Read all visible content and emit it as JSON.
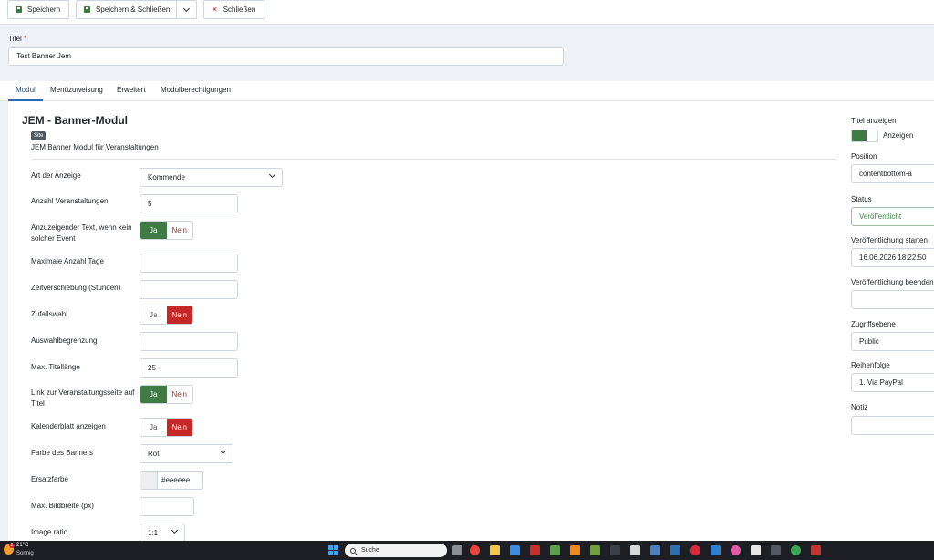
{
  "toolbar": {
    "save": "Speichern",
    "save_close": "Speichern & Schließen",
    "close": "Schließen"
  },
  "title_field": {
    "label": "Titel",
    "required": "*",
    "value": "Test Banner Jem"
  },
  "tabs": [
    "Modul",
    "Menüzuweisung",
    "Erweitert",
    "Modulberechtigungen"
  ],
  "module": {
    "name": "JEM - Banner-Modul",
    "badge": "Site",
    "description": "JEM Banner Modul für Veranstaltungen"
  },
  "fields": {
    "art_label": "Art der Anzeige",
    "art_value": "Kommende",
    "anzahl_label": "Anzahl Veranstaltungen",
    "anzahl_value": "5",
    "text_label": "Anzuzeigender Text, wenn kein solcher Event",
    "max_tage_label": "Maximale Anzahl Tage",
    "zeit_label": "Zeitverschiebung (Stunden)",
    "zufall_label": "Zufallswahl",
    "auswahl_label": "Auswahlbegrenzung",
    "titel_len_label": "Max. Titellänge",
    "titel_len_value": "25",
    "link_label": "Link zur Veranstaltungsseite auf Titel",
    "kalender_label": "Kalenderblatt anzeigen",
    "farbe_label": "Farbe des Banners",
    "farbe_value": "Rot",
    "ersatz_label": "Ersatzfarbe",
    "ersatz_value": "#eeeeee",
    "bildbreite_label": "Max. Bildbreite (px)",
    "ratio_label": "Image ratio",
    "ratio_value": "1:1"
  },
  "switch": {
    "ja": "Ja",
    "nein": "Nein"
  },
  "sidebar": {
    "titel_anzeigen_label": "Titel anzeigen",
    "titel_anzeigen_value": "Anzeigen",
    "position_label": "Position",
    "position_value": "contentbottom-a",
    "status_label": "Status",
    "status_value": "Veröffentlicht",
    "start_label": "Veröffentlichung starten",
    "start_value": "16.06.2026 18:22:50",
    "ende_label": "Veröffentlichung beenden",
    "zugriff_label": "Zugriffsebene",
    "zugriff_value": "Public",
    "reihenfolge_label": "Reihenfolge",
    "reihenfolge_value": "1. Via PayPal",
    "notiz_label": "Notiz"
  },
  "taskbar": {
    "temp": "21°C",
    "condition": "Sonnig",
    "badge": "2",
    "search_placeholder": "Suche"
  },
  "colors": {
    "green": "#3f7b45",
    "red": "#c52827",
    "tab_accent": "#2a69b8"
  }
}
